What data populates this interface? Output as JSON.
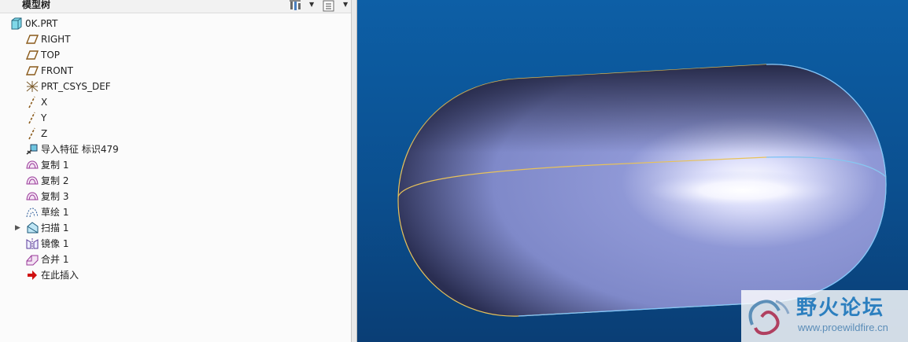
{
  "panel": {
    "title": "模型树"
  },
  "tree": {
    "items": [
      {
        "label": "0K.PRT",
        "icon": "part-icon"
      },
      {
        "label": "RIGHT",
        "icon": "datum-plane-icon"
      },
      {
        "label": "TOP",
        "icon": "datum-plane-icon"
      },
      {
        "label": "FRONT",
        "icon": "datum-plane-icon"
      },
      {
        "label": "PRT_CSYS_DEF",
        "icon": "coordinate-system-icon"
      },
      {
        "label": "X",
        "icon": "datum-axis-icon"
      },
      {
        "label": "Y",
        "icon": "datum-axis-icon"
      },
      {
        "label": "Z",
        "icon": "datum-axis-icon"
      },
      {
        "label": "导入特征 标识479",
        "icon": "import-feature-icon"
      },
      {
        "label": "复制 1",
        "icon": "copy-surface-icon"
      },
      {
        "label": "复制 2",
        "icon": "copy-surface-icon"
      },
      {
        "label": "复制 3",
        "icon": "copy-surface-icon"
      },
      {
        "label": "草绘 1",
        "icon": "sketch-icon"
      },
      {
        "label": "扫描 1",
        "icon": "sweep-icon"
      },
      {
        "label": "镜像 1",
        "icon": "mirror-icon"
      },
      {
        "label": "合并 1",
        "icon": "merge-icon"
      },
      {
        "label": "在此插入",
        "icon": "insert-here-arrow-icon"
      }
    ]
  },
  "watermark": {
    "text": "野火论坛",
    "url": "www.proewildfire.cn"
  },
  "colors": {
    "viewport_top": "#0d5fa6",
    "viewport_bottom": "#0a3e75",
    "edge_highlight": "#e8c25a",
    "edge_blue": "#7fc4ff"
  }
}
